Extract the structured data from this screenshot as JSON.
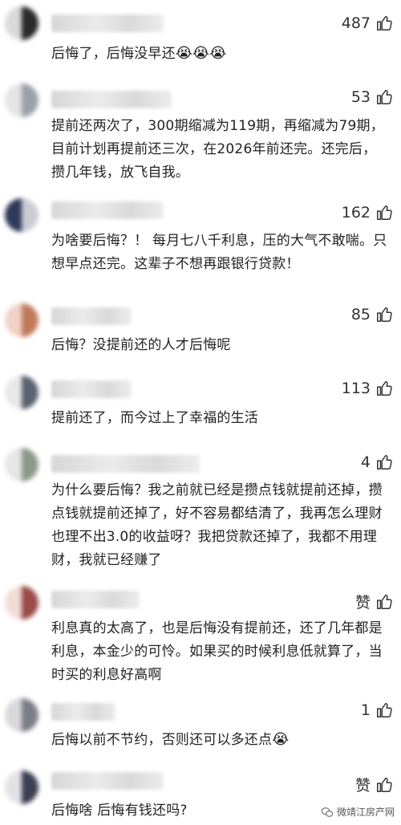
{
  "comments": [
    {
      "likes": "487",
      "text": "后悔了，后悔没早还",
      "emoji": "😭😭😭"
    },
    {
      "likes": "53",
      "text": "提前还两次了，300期缩减为119期，再缩减为79期，目前计划再提前还三次，在2026年前还完。还完后，攒几年钱，放飞自我。"
    },
    {
      "likes": "162",
      "text": "为啥要后悔？！ 每月七八千利息，压的大气不敢喘。只想早点还完。这辈子不想再跟银行贷款！"
    },
    {
      "likes": "85",
      "text": "后悔？没提前还的人才后悔呢"
    },
    {
      "likes": "113",
      "text": "提前还了，而今过上了幸福的生活"
    },
    {
      "likes": "4",
      "text": "为什么要后悔？我之前就已经是攒点钱就提前还掉，攒点钱就提前还掉了，好不容易都结清了，我再怎么理财也理不出3.0的收益呀？我把贷款还掉了，我都不用理财，我就已经赚了"
    },
    {
      "likes": "赞",
      "text": "利息真的太高了，也是后悔没有提前还，还了几年都是利息，本金少的可怜。如果买的时候利息低就算了，当时买的利息好高啊"
    },
    {
      "likes": "1",
      "text": "后悔以前不节约，否则还可以多还点",
      "emoji": "😭"
    },
    {
      "likes": "赞",
      "text": "后悔啥 后悔有钱还吗?"
    }
  ],
  "watermark": "微靖江房产网",
  "icons": {
    "like": "thumbs-up-icon",
    "watermark": "wechat-icon"
  }
}
